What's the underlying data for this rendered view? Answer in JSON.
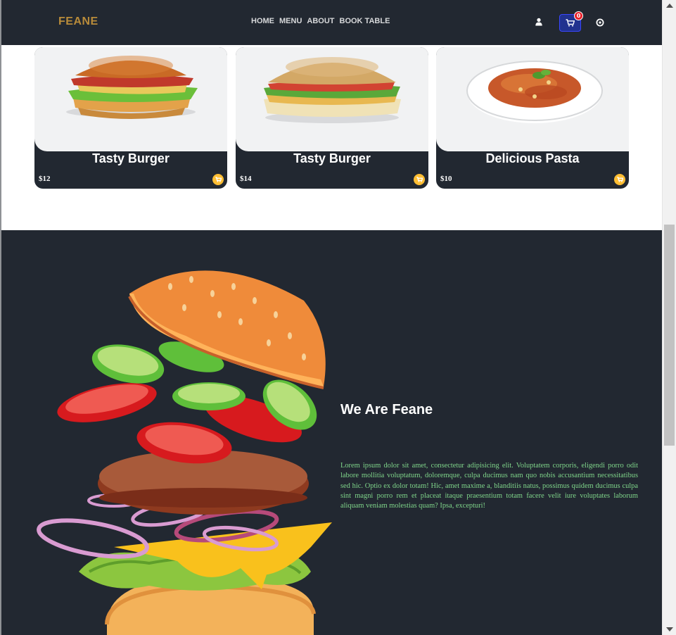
{
  "nav": {
    "brand": "FEANE",
    "links": [
      "HOME",
      "MENU",
      "ABOUT",
      "BOOK TABLE"
    ],
    "cart_count": "0",
    "icons": {
      "user": "user-icon",
      "cart": "cart-icon",
      "search": "search-icon"
    }
  },
  "menu": {
    "items": [
      {
        "name": "Tasty Burger",
        "price": "$12",
        "image": "chicken-burger"
      },
      {
        "name": "Tasty Burger",
        "price": "$14",
        "image": "sandwich"
      },
      {
        "name": "Delicious Pasta",
        "price": "$10",
        "image": "pasta-plate"
      }
    ]
  },
  "about": {
    "title": "We Are Feane",
    "text": "Lorem ipsum dolor sit amet, consectetur adipisicing elit. Voluptatem corporis, eligendi porro odit labore mollitia voluptatum, doloremque, culpa ducimus nam quo nobis accusantium necessitatibus sed hic. Optio ex dolor totam! Hic, amet maxime a, blanditiis natus, possimus quidem ducimus culpa sint magni porro rem et placeat itaque praesentium totam facere velit iure voluptates laborum aliquam veniam molestias quam? Ipsa, excepturi!"
  },
  "colors": {
    "dark": "#222831",
    "brand": "#b88b3a",
    "accent": "#ffbe33",
    "about_text": "#7fd58a",
    "cart_badge": "#e8212a"
  }
}
